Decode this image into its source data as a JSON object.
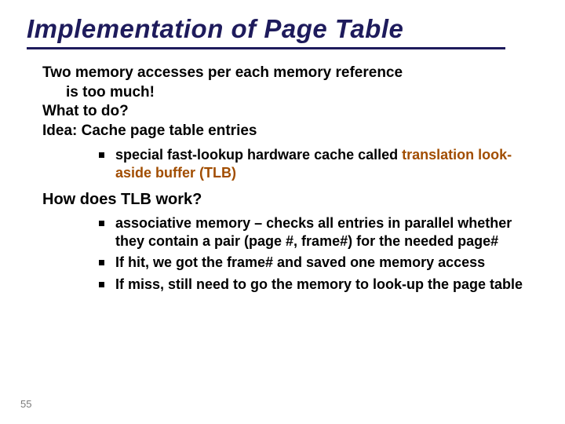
{
  "title": "Implementation of Page Table",
  "intro": {
    "line1": "Two memory accesses per each memory reference",
    "line1b": "is too much!",
    "line2": "What to do?",
    "line3_prefix": "Idea: ",
    "line3_bold": "Cache page table entries"
  },
  "sub1": {
    "item1_pre": "special fast-lookup hardware cache called ",
    "item1_hl": "translation look-aside buffer (TLB)"
  },
  "section2_title": "How does TLB work?",
  "sub2": {
    "item1": "associative memory – checks all entries in parallel whether they contain a pair  (page #, frame#) for the needed page#",
    "item2": "If hit, we got the frame# and saved one memory access",
    "item3": "If miss, still need to go the memory to look-up the page table"
  },
  "page_number": "55"
}
